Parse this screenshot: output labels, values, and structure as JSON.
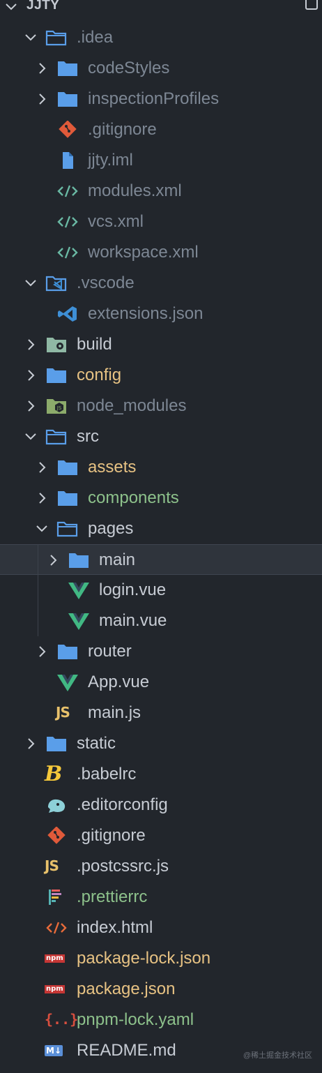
{
  "explorer": {
    "title": "JJTY"
  },
  "colors": {
    "background": "#22262c",
    "default_text": "#c7ccd4",
    "dim_text": "#7d8794",
    "config_text": "#e7c283",
    "git_text": "#8dc18b",
    "selected_bg": "#2f343c",
    "folder_blue": "#5a9ee9"
  },
  "rows": [
    {
      "label": ".idea",
      "icon": "folder-open-icon",
      "expanded": true,
      "depth": 0
    },
    {
      "label": "codeStyles",
      "icon": "folder-icon",
      "expanded": false,
      "depth": 1
    },
    {
      "label": "inspectionProfiles",
      "icon": "folder-icon",
      "expanded": false,
      "depth": 1
    },
    {
      "label": ".gitignore",
      "icon": "git-icon",
      "depth": 1
    },
    {
      "label": "jjty.iml",
      "icon": "file-icon",
      "depth": 1
    },
    {
      "label": "modules.xml",
      "icon": "xml-icon",
      "depth": 1
    },
    {
      "label": "vcs.xml",
      "icon": "xml-icon",
      "depth": 1
    },
    {
      "label": "workspace.xml",
      "icon": "xml-icon",
      "depth": 1
    },
    {
      "label": ".vscode",
      "icon": "vscode-folder-icon",
      "expanded": true,
      "depth": 0
    },
    {
      "label": "extensions.json",
      "icon": "vscode-icon",
      "depth": 1
    },
    {
      "label": "build",
      "icon": "gear-folder-icon",
      "expanded": false,
      "depth": 0
    },
    {
      "label": "config",
      "icon": "folder-icon",
      "expanded": false,
      "depth": 0
    },
    {
      "label": "node_modules",
      "icon": "node-folder-icon",
      "expanded": false,
      "depth": 0
    },
    {
      "label": "src",
      "icon": "folder-open-icon",
      "expanded": true,
      "depth": 0
    },
    {
      "label": "assets",
      "icon": "folder-icon",
      "expanded": false,
      "depth": 1
    },
    {
      "label": "components",
      "icon": "folder-icon",
      "expanded": false,
      "depth": 1
    },
    {
      "label": "pages",
      "icon": "folder-open-icon",
      "expanded": true,
      "depth": 1
    },
    {
      "label": "main",
      "icon": "folder-icon",
      "expanded": false,
      "depth": 2,
      "selected": true
    },
    {
      "label": "login.vue",
      "icon": "vue-icon",
      "depth": 2
    },
    {
      "label": "main.vue",
      "icon": "vue-icon",
      "depth": 2
    },
    {
      "label": "router",
      "icon": "folder-icon",
      "expanded": false,
      "depth": 1
    },
    {
      "label": "App.vue",
      "icon": "vue-icon",
      "depth": 1
    },
    {
      "label": "main.js",
      "icon": "js-icon",
      "depth": 1
    },
    {
      "label": "static",
      "icon": "folder-icon",
      "expanded": false,
      "depth": 0
    },
    {
      "label": ".babelrc",
      "icon": "babel-icon",
      "depth": 0
    },
    {
      "label": ".editorconfig",
      "icon": "editorconfig-icon",
      "depth": 0
    },
    {
      "label": ".gitignore",
      "icon": "git-icon",
      "depth": 0
    },
    {
      "label": ".postcssrc.js",
      "icon": "js-icon",
      "depth": 0
    },
    {
      "label": ".prettierrc",
      "icon": "prettier-icon",
      "depth": 0
    },
    {
      "label": "index.html",
      "icon": "html-icon",
      "depth": 0
    },
    {
      "label": "package-lock.json",
      "icon": "npm-icon",
      "depth": 0
    },
    {
      "label": "package.json",
      "icon": "npm-icon",
      "depth": 0
    },
    {
      "label": "pnpm-lock.yaml",
      "icon": "yaml-icon",
      "depth": 0
    },
    {
      "label": "README.md",
      "icon": "markdown-icon",
      "depth": 0
    }
  ],
  "watermark": "@稀土掘金技术社区"
}
